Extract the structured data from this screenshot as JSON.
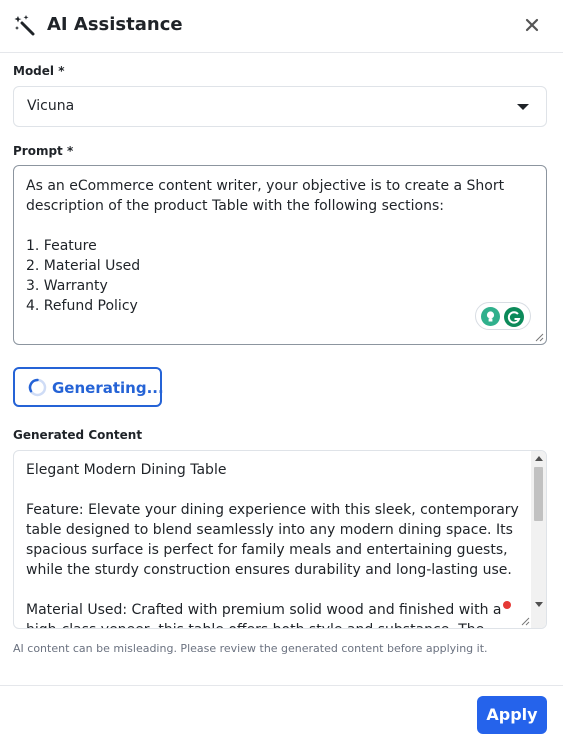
{
  "header": {
    "title": "AI Assistance",
    "icon": "magic-wand-icon",
    "close_icon": "close-icon"
  },
  "model": {
    "label": "Model *",
    "value": "Vicuna"
  },
  "prompt": {
    "label": "Prompt *",
    "value": "As an eCommerce content writer, your objective is to create a Short description of the product Table with the following sections:\n\n1. Feature\n2. Material Used\n3. Warranty\n4. Refund Policy"
  },
  "generate": {
    "label": "Generating..."
  },
  "generated": {
    "label": "Generated Content",
    "paragraphs": [
      "Elegant Modern Dining Table",
      "Feature: Elevate your dining experience with this sleek, contemporary table designed to blend seamlessly into any modern dining space. Its spacious surface is perfect for family meals and entertaining guests, while the sturdy construction ensures durability and long-lasting use.",
      "Material Used: Crafted with premium solid wood and finished with a high-class veneer, this table offers both style and substance. The materials are"
    ]
  },
  "disclaimer": "AI content can be misleading. Please review the generated content before applying it.",
  "footer": {
    "apply_label": "Apply"
  },
  "colors": {
    "primary": "#2563eb",
    "grammarly_green": "#0c8a5a",
    "indicator_red": "#e53935"
  }
}
